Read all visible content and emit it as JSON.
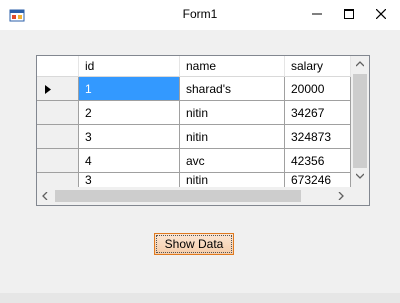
{
  "window": {
    "title": "Form1",
    "icons": {
      "app": "app-icon",
      "minimize": "minimize-icon",
      "maximize": "maximize-icon",
      "close": "close-icon"
    }
  },
  "grid": {
    "columns": [
      "id",
      "name",
      "salary"
    ],
    "current_row_indicator": "row-arrow-icon",
    "rows": [
      {
        "id": "1",
        "name": "sharad's",
        "salary": "20000"
      },
      {
        "id": "2",
        "name": "nitin",
        "salary": "34267"
      },
      {
        "id": "3",
        "name": "nitin",
        "salary": "324873"
      },
      {
        "id": "4",
        "name": "avc",
        "salary": "42356"
      },
      {
        "id": "3",
        "name": "nitin",
        "salary": "673246"
      }
    ],
    "selection_color": "#3399ff"
  },
  "button": {
    "label": "Show Data",
    "border_color": "#e07a1f"
  }
}
